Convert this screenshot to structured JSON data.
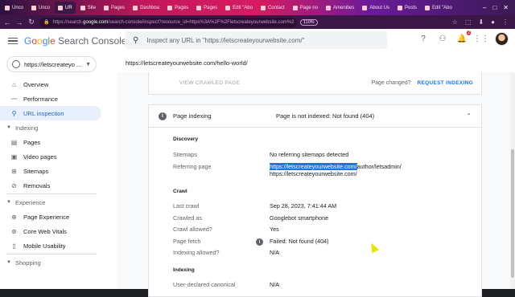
{
  "browser": {
    "tabs": [
      {
        "label": "Unco"
      },
      {
        "label": "Unco"
      },
      {
        "label": "UR",
        "active": true
      },
      {
        "label": "Site"
      },
      {
        "label": "Pages"
      },
      {
        "label": "Dashboa"
      },
      {
        "label": "Pages"
      },
      {
        "label": "Pages"
      },
      {
        "label": "Edit \"Abo"
      },
      {
        "label": "Contact"
      },
      {
        "label": "Page no"
      },
      {
        "label": "Amenities"
      },
      {
        "label": "About Us"
      },
      {
        "label": "Posts"
      },
      {
        "label": "Edit \"Abo"
      }
    ],
    "url_prefix": "https://search.",
    "url_domain": "google.com",
    "url_rest": "/search-console/inspect?resource_id=https%3A%2F%2Fletscreateyourwebsite.com%2",
    "zoom": "110%"
  },
  "header": {
    "product_name": "Google Search Console",
    "search_placeholder": "Inspect any URL in \"https://letscreateyourwebsite.com/\"",
    "notification_count": "2"
  },
  "property": {
    "name": "https://letscreateyo ..."
  },
  "sidebar": {
    "items": [
      {
        "label": "Overview",
        "icon": "home-icon"
      },
      {
        "label": "Performance",
        "icon": "trend-icon"
      },
      {
        "label": "URL inspection",
        "icon": "search-icon",
        "active": true
      }
    ],
    "indexing": {
      "title": "Indexing",
      "items": [
        {
          "label": "Pages",
          "icon": "pages-icon"
        },
        {
          "label": "Video pages",
          "icon": "video-pages-icon"
        },
        {
          "label": "Sitemaps",
          "icon": "sitemaps-icon"
        },
        {
          "label": "Removals",
          "icon": "removals-icon"
        }
      ]
    },
    "experience": {
      "title": "Experience",
      "items": [
        {
          "label": "Page Experience",
          "icon": "page-experience-icon"
        },
        {
          "label": "Core Web Vitals",
          "icon": "core-web-vitals-icon"
        },
        {
          "label": "Mobile Usability",
          "icon": "mobile-usability-icon"
        }
      ]
    },
    "shopping": {
      "title": "Shopping"
    }
  },
  "main": {
    "inspected_url": "https://letscreateyourwebsite.com/hello-world/",
    "view_crawled": "VIEW CRAWLED PAGE",
    "page_changed": "Page changed?",
    "request_indexing": "REQUEST INDEXING",
    "index_title": "Page indexing",
    "index_status": "Page is not indexed: Not found (404)",
    "discovery": {
      "title": "Discovery",
      "sitemaps_label": "Sitemaps",
      "sitemaps_value": "No referring sitemaps detected",
      "referring_label": "Referring page",
      "referring_highlight": "https://letscreateyourwebsite.com/",
      "referring_rest": "author/letsadmin/",
      "referring_second": "https://letscreateyourwebsite.com/"
    },
    "crawl": {
      "title": "Crawl",
      "last_crawl_label": "Last crawl",
      "last_crawl_value": "Sep 28, 2023, 7:41:44 AM",
      "crawled_as_label": "Crawled as",
      "crawled_as_value": "Googlebot smartphone",
      "crawl_allowed_label": "Crawl allowed?",
      "crawl_allowed_value": "Yes",
      "page_fetch_label": "Page fetch",
      "page_fetch_value": "Failed: Not found (404)",
      "indexing_allowed_label": "Indexing allowed?",
      "indexing_allowed_value": "N/A"
    },
    "indexing": {
      "title": "Indexing",
      "canonical_label": "User-declared canonical",
      "canonical_value": "N/A"
    }
  }
}
